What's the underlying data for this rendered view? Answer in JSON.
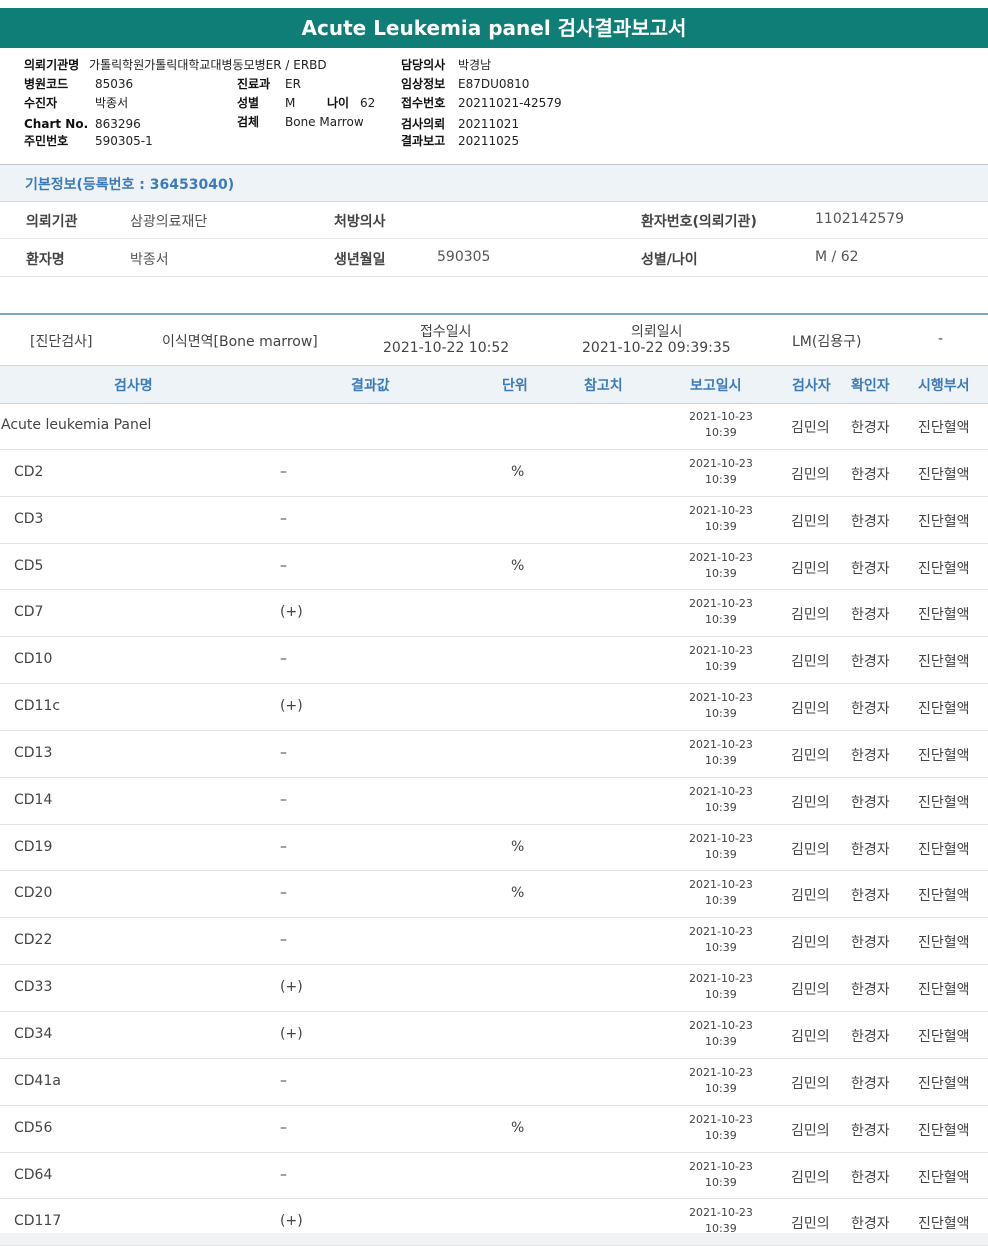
{
  "report_title": "Acute Leukemia panel 검사결과보고서",
  "header": {
    "institution_label": "의뢰기관명",
    "institution_value": "가톨릭학원가톨릭대학교대병동모병ER / ERBD",
    "hospital_code_label": "병원코드",
    "hospital_code_value": "85036",
    "patient_label": "수진자",
    "patient_value": "박종서",
    "chart_label": "Chart No.",
    "chart_value": "863296",
    "resident_label": "주민번호",
    "resident_value": "590305-1",
    "dept_label": "진료과",
    "dept_value": "ER",
    "sex_label": "성별",
    "sex_value": "M",
    "age_label": "나이",
    "age_value": "62",
    "specimen_label": "검체",
    "specimen_value": "Bone Marrow",
    "doctor_label": "담당의사",
    "doctor_value": "박경남",
    "clinical_label": "임상정보",
    "clinical_value": "E87DU0810",
    "accession_label": "접수번호",
    "accession_value": "20211021-42579",
    "request_label": "검사의뢰",
    "request_value": "20211021",
    "report_label": "결과보고",
    "report_value": "20211025"
  },
  "basic_info": {
    "title": "기본정보(등록번호 : 36453040)",
    "row1": {
      "k1": "의뢰기관",
      "v1": "삼광의료재단",
      "k2": "처방의사",
      "v2": "",
      "k3": "환자번호(의뢰기관)",
      "v3": "1102142579"
    },
    "row2": {
      "k1": "환자명",
      "v1": "박종서",
      "k2": "생년월일",
      "v2": "590305",
      "k3": "성별/나이",
      "v3": "M / 62"
    }
  },
  "order": {
    "category": "[진단검사]",
    "test": "이식면역[Bone marrow]",
    "received_label": "접수일시",
    "received_value": "2021-10-22 10:52",
    "requested_label": "의뢰일시",
    "requested_value": "2021-10-22 09:39:35",
    "lm": "LM(김용구)",
    "extra": "-"
  },
  "table": {
    "headers": {
      "name": "검사명",
      "result": "결과값",
      "unit": "단위",
      "ref": "참고치",
      "report": "보고일시",
      "tester": "검사자",
      "confirmer": "확인자",
      "dept": "시행부서"
    },
    "rows": [
      {
        "name": "Acute leukemia Panel",
        "result": "",
        "unit": "",
        "date": "2021-10-23",
        "time": "10:39",
        "tester": "김민의",
        "confirmer": "한경자",
        "dept": "진단혈액"
      },
      {
        "name": "CD2",
        "result": "–",
        "unit": "%",
        "date": "2021-10-23",
        "time": "10:39",
        "tester": "김민의",
        "confirmer": "한경자",
        "dept": "진단혈액"
      },
      {
        "name": "CD3",
        "result": "–",
        "unit": "",
        "date": "2021-10-23",
        "time": "10:39",
        "tester": "김민의",
        "confirmer": "한경자",
        "dept": "진단혈액"
      },
      {
        "name": "CD5",
        "result": "–",
        "unit": "%",
        "date": "2021-10-23",
        "time": "10:39",
        "tester": "김민의",
        "confirmer": "한경자",
        "dept": "진단혈액"
      },
      {
        "name": "CD7",
        "result": "(+)",
        "unit": "",
        "date": "2021-10-23",
        "time": "10:39",
        "tester": "김민의",
        "confirmer": "한경자",
        "dept": "진단혈액"
      },
      {
        "name": "CD10",
        "result": "–",
        "unit": "",
        "date": "2021-10-23",
        "time": "10:39",
        "tester": "김민의",
        "confirmer": "한경자",
        "dept": "진단혈액"
      },
      {
        "name": "CD11c",
        "result": "(+)",
        "unit": "",
        "date": "2021-10-23",
        "time": "10:39",
        "tester": "김민의",
        "confirmer": "한경자",
        "dept": "진단혈액"
      },
      {
        "name": "CD13",
        "result": "–",
        "unit": "",
        "date": "2021-10-23",
        "time": "10:39",
        "tester": "김민의",
        "confirmer": "한경자",
        "dept": "진단혈액"
      },
      {
        "name": "CD14",
        "result": "–",
        "unit": "",
        "date": "2021-10-23",
        "time": "10:39",
        "tester": "김민의",
        "confirmer": "한경자",
        "dept": "진단혈액"
      },
      {
        "name": "CD19",
        "result": "–",
        "unit": "%",
        "date": "2021-10-23",
        "time": "10:39",
        "tester": "김민의",
        "confirmer": "한경자",
        "dept": "진단혈액"
      },
      {
        "name": "CD20",
        "result": "–",
        "unit": "%",
        "date": "2021-10-23",
        "time": "10:39",
        "tester": "김민의",
        "confirmer": "한경자",
        "dept": "진단혈액"
      },
      {
        "name": "CD22",
        "result": "–",
        "unit": "",
        "date": "2021-10-23",
        "time": "10:39",
        "tester": "김민의",
        "confirmer": "한경자",
        "dept": "진단혈액"
      },
      {
        "name": "CD33",
        "result": "(+)",
        "unit": "",
        "date": "2021-10-23",
        "time": "10:39",
        "tester": "김민의",
        "confirmer": "한경자",
        "dept": "진단혈액"
      },
      {
        "name": "CD34",
        "result": "(+)",
        "unit": "",
        "date": "2021-10-23",
        "time": "10:39",
        "tester": "김민의",
        "confirmer": "한경자",
        "dept": "진단혈액"
      },
      {
        "name": "CD41a",
        "result": "–",
        "unit": "",
        "date": "2021-10-23",
        "time": "10:39",
        "tester": "김민의",
        "confirmer": "한경자",
        "dept": "진단혈액"
      },
      {
        "name": "CD56",
        "result": "–",
        "unit": "%",
        "date": "2021-10-23",
        "time": "10:39",
        "tester": "김민의",
        "confirmer": "한경자",
        "dept": "진단혈액"
      },
      {
        "name": "CD64",
        "result": "–",
        "unit": "",
        "date": "2021-10-23",
        "time": "10:39",
        "tester": "김민의",
        "confirmer": "한경자",
        "dept": "진단혈액"
      },
      {
        "name": "CD117",
        "result": "(+)",
        "unit": "",
        "date": "2021-10-23",
        "time": "10:39",
        "tester": "김민의",
        "confirmer": "한경자",
        "dept": "진단혈액"
      }
    ]
  }
}
